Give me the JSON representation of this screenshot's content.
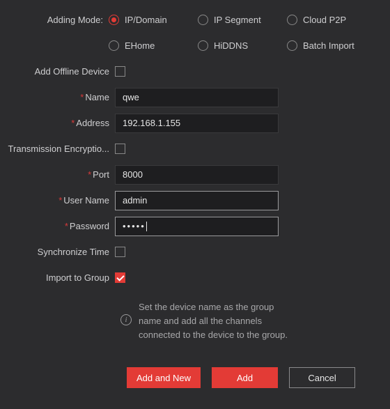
{
  "labels": {
    "adding_mode": "Adding Mode:",
    "add_offline": "Add Offline Device",
    "name": "Name",
    "address": "Address",
    "trans_enc": "Transmission Encryptio...",
    "port": "Port",
    "username": "User Name",
    "password": "Password",
    "sync_time": "Synchronize Time",
    "import_group": "Import to Group"
  },
  "radios": {
    "row1": [
      {
        "key": "ip_domain",
        "label": "IP/Domain",
        "selected": true
      },
      {
        "key": "ip_segment",
        "label": "IP Segment",
        "selected": false
      },
      {
        "key": "cloud_p2p",
        "label": "Cloud P2P",
        "selected": false
      }
    ],
    "row2": [
      {
        "key": "ehome",
        "label": "EHome",
        "selected": false
      },
      {
        "key": "hiddns",
        "label": "HiDDNS",
        "selected": false
      },
      {
        "key": "batch_import",
        "label": "Batch Import",
        "selected": false
      }
    ]
  },
  "values": {
    "add_offline": false,
    "name": "qwe",
    "address": "192.168.1.155",
    "trans_enc": false,
    "port": "8000",
    "username": "admin",
    "password": "•••••",
    "sync_time": false,
    "import_group": true
  },
  "info": "Set the device name as the group name and add all the channels connected to the device to the group.",
  "buttons": {
    "add_new": "Add and New",
    "add": "Add",
    "cancel": "Cancel"
  }
}
